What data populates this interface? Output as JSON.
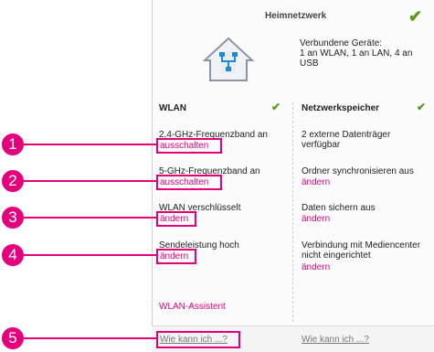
{
  "heimnetzwerk": {
    "title": "Heimnetzwerk",
    "devices": "Verbundene Geräte:\n1 an WLAN, 1 an LAN, 4 an USB"
  },
  "wlan": {
    "header": "WLAN",
    "band24": "2,4-GHz-Frequenzband an",
    "band24_action": "ausschalten",
    "band5": "5-GHz-Frequenzband an",
    "band5_action": "ausschalten",
    "encryption": "WLAN verschlüsselt",
    "encryption_action": "ändern",
    "power": "Sendeleistung hoch",
    "power_action": "ändern",
    "assistant": "WLAN-Assistent",
    "howto": "Wie kann ich ...?"
  },
  "storage": {
    "header": "Netzwerkspeicher",
    "drives": "2 externe Datenträger verfügbar",
    "sync": "Ordner synchronisieren aus",
    "sync_action": "ändern",
    "backup": "Daten sichern aus",
    "backup_action": "ändern",
    "media": "Verbindung mit Mediencenter nicht eingerichtet",
    "media_action": "ändern",
    "howto": "Wie kann ich ...?"
  },
  "callouts": [
    "1",
    "2",
    "3",
    "4",
    "5"
  ],
  "colors": {
    "accent": "#e4007c",
    "check": "#5a9a1a"
  }
}
